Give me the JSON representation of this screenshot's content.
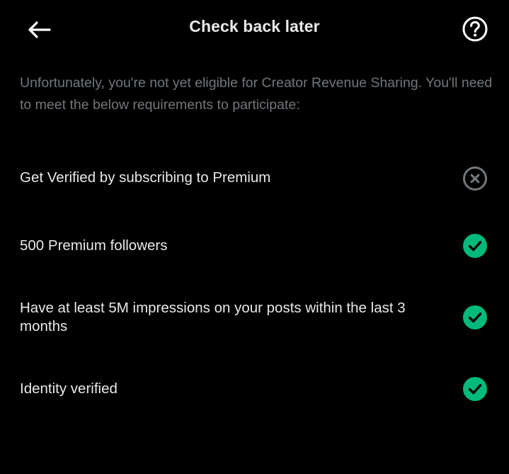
{
  "header": {
    "title": "Check back later",
    "back_icon": "arrow-left-icon",
    "help_icon": "question-circle-icon"
  },
  "intro_text": "Unfortunately, you're not yet eligible for Creator Revenue Sharing. You'll need to meet the below requirements to participate:",
  "requirements": [
    {
      "label": "Get Verified by subscribing to Premium",
      "met": false,
      "icon": "x-circle-icon"
    },
    {
      "label": "500 Premium followers",
      "met": true,
      "icon": "check-circle-icon"
    },
    {
      "label": "Have at least 5M impressions on your posts within the last 3 months",
      "met": true,
      "icon": "check-circle-icon"
    },
    {
      "label": "Identity verified",
      "met": true,
      "icon": "check-circle-icon"
    }
  ],
  "colors": {
    "background": "#000000",
    "text_primary": "#e7e9ea",
    "text_secondary": "#71767b",
    "success": "#00ba7c",
    "unmet": "#71767b"
  }
}
